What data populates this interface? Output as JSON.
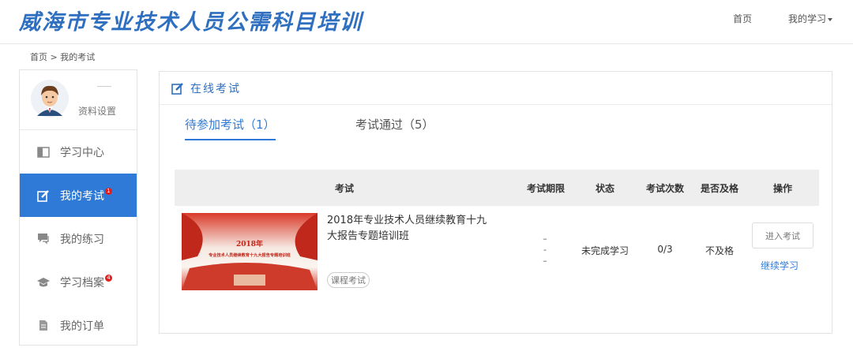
{
  "header": {
    "site_title": "威海市专业技术人员公需科目培训",
    "nav_home": "首页",
    "nav_my_learning": "我的学习"
  },
  "breadcrumb": "首页 > 我的考试",
  "sidebar": {
    "profile_settings": "资料设置",
    "items": [
      {
        "label": "学习中心",
        "icon": "book-icon",
        "badge": ""
      },
      {
        "label": "我的考试",
        "icon": "edit-icon",
        "badge": "1"
      },
      {
        "label": "我的练习",
        "icon": "chat-icon",
        "badge": ""
      },
      {
        "label": "学习档案",
        "icon": "graduation-cap-icon",
        "badge": "4"
      },
      {
        "label": "我的订单",
        "icon": "document-icon",
        "badge": ""
      }
    ]
  },
  "main": {
    "title": "在线考试",
    "tabs": [
      {
        "label": "待参加考试（1）"
      },
      {
        "label": "考试通过（5）"
      }
    ],
    "table": {
      "headers": [
        "考试",
        "考试期限",
        "状态",
        "考试次数",
        "是否及格",
        "操作"
      ],
      "rows": [
        {
          "thumb_year": "2018年",
          "thumb_caption": "专业技术人员继续教育十九大报告专题培训班",
          "title": "2018年专业技术人员继续教育十九大报告专题培训班",
          "tag": "课程考试",
          "period": [
            "–",
            "-",
            "–"
          ],
          "status": "未完成学习",
          "attempts": "0/3",
          "passed": "不及格",
          "action_primary": "进入考试",
          "action_secondary": "继续学习"
        }
      ]
    }
  },
  "colors": {
    "accent": "#2f7ad6",
    "title_blue": "#2f6fc0",
    "badge_red": "#e01e1e"
  }
}
